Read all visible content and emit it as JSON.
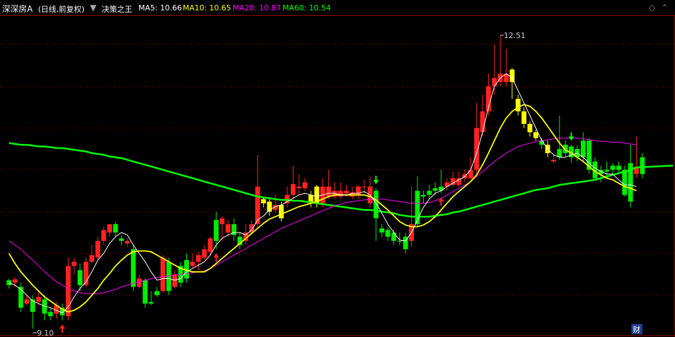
{
  "header": {
    "stock_name": "深深房A",
    "period": "(日线,前复权)",
    "indicator_name": "决策之王",
    "ma_items": [
      {
        "label": "MA5: 10.66",
        "color": "#ffffff"
      },
      {
        "label": "MA10: 10.65",
        "color": "#ffff00"
      },
      {
        "label": "MA20: 10.87",
        "color": "#ff00ff"
      },
      {
        "label": "MA60: 10.54",
        "color": "#00ff00"
      }
    ]
  },
  "chart_data": {
    "type": "candlestick",
    "colors": {
      "up": "#ff2222",
      "down": "#00ee00",
      "signal": "#ffff00",
      "grid": "#9a0000",
      "ma5": "#ffffff",
      "ma10": "#ffff00",
      "ma20": "#ff00ff",
      "ma60": "#00ff00"
    },
    "ylim": [
      8.9,
      12.75
    ],
    "annotations": {
      "high": {
        "value": 12.51,
        "label": "12.51"
      },
      "low": {
        "value": 9.1,
        "label": "9.10"
      }
    },
    "badge": "财",
    "candles": [
      [
        9.58,
        9.52,
        9.6,
        9.48,
        "down"
      ],
      [
        9.55,
        9.59,
        9.62,
        9.5,
        "up"
      ],
      [
        9.5,
        9.25,
        9.55,
        9.2,
        "down"
      ],
      [
        9.3,
        9.35,
        9.4,
        9.28,
        "up"
      ],
      [
        9.35,
        9.2,
        9.4,
        9.0,
        "down"
      ],
      [
        9.32,
        9.38,
        9.45,
        9.28,
        "up"
      ],
      [
        9.35,
        9.18,
        9.4,
        9.1,
        "down"
      ],
      [
        9.2,
        9.15,
        9.25,
        9.1,
        "down"
      ],
      [
        9.18,
        9.28,
        9.32,
        9.12,
        "up"
      ],
      [
        9.25,
        9.16,
        9.3,
        9.1,
        "down"
      ],
      [
        9.15,
        9.75,
        9.85,
        9.1,
        "up"
      ],
      [
        9.75,
        9.8,
        9.85,
        9.65,
        "up"
      ],
      [
        9.7,
        9.52,
        9.78,
        9.45,
        "down"
      ],
      [
        9.52,
        9.8,
        9.85,
        9.5,
        "up"
      ],
      [
        9.8,
        9.88,
        10.0,
        9.78,
        "up"
      ],
      [
        9.85,
        10.05,
        10.1,
        9.82,
        "up"
      ],
      [
        10.05,
        10.18,
        10.22,
        10.0,
        "up"
      ],
      [
        10.15,
        10.25,
        10.25,
        10.1,
        "up"
      ],
      [
        10.25,
        10.15,
        10.28,
        10.1,
        "down"
      ],
      [
        10.08,
        10.05,
        10.12,
        10.0,
        "down"
      ],
      [
        10.05,
        10.02,
        10.08,
        9.98,
        "up"
      ],
      [
        9.95,
        9.5,
        10.0,
        9.45,
        "down"
      ],
      [
        9.5,
        9.6,
        9.65,
        9.48,
        "up"
      ],
      [
        9.58,
        9.3,
        9.6,
        9.25,
        "down"
      ],
      [
        9.3,
        9.32,
        9.45,
        9.28,
        "down"
      ],
      [
        9.45,
        9.4,
        9.5,
        9.38,
        "down"
      ],
      [
        9.45,
        9.85,
        9.88,
        9.43,
        "up"
      ],
      [
        9.8,
        9.45,
        9.85,
        9.4,
        "down"
      ],
      [
        9.5,
        9.65,
        9.7,
        9.48,
        "up"
      ],
      [
        9.75,
        9.55,
        9.8,
        9.5,
        "down"
      ],
      [
        9.82,
        9.6,
        9.9,
        9.55,
        "down"
      ],
      [
        9.75,
        9.8,
        9.9,
        9.72,
        "up"
      ],
      [
        9.8,
        9.88,
        9.92,
        9.7,
        "up"
      ],
      [
        9.85,
        9.95,
        10.0,
        9.82,
        "up"
      ],
      [
        9.92,
        10.08,
        10.1,
        9.88,
        "up"
      ],
      [
        10.05,
        10.3,
        10.4,
        9.95,
        "down"
      ],
      [
        10.25,
        10.32,
        10.35,
        10.05,
        "up"
      ],
      [
        10.25,
        10.15,
        10.3,
        10.1,
        "up"
      ],
      [
        10.25,
        10.12,
        10.32,
        10.05,
        "down"
      ],
      [
        10.1,
        10.0,
        10.15,
        9.95,
        "down"
      ],
      [
        10.05,
        10.15,
        10.25,
        10.0,
        "up"
      ],
      [
        10.15,
        10.25,
        10.3,
        10.12,
        "up"
      ],
      [
        10.25,
        10.7,
        11.08,
        10.2,
        "up"
      ],
      [
        10.55,
        10.5,
        10.58,
        10.45,
        "signal"
      ],
      [
        10.52,
        10.4,
        10.55,
        10.35,
        "signal"
      ],
      [
        10.42,
        10.48,
        10.6,
        10.38,
        "up"
      ],
      [
        10.48,
        10.32,
        10.52,
        10.28,
        "signal"
      ],
      [
        10.5,
        10.6,
        10.7,
        10.45,
        "up"
      ],
      [
        10.6,
        10.73,
        10.95,
        10.55,
        "up"
      ],
      [
        10.7,
        10.68,
        10.85,
        10.6,
        "up"
      ],
      [
        10.75,
        10.68,
        10.8,
        10.65,
        "up"
      ],
      [
        10.6,
        10.5,
        10.65,
        10.45,
        "signal"
      ],
      [
        10.7,
        10.5,
        10.72,
        10.45,
        "signal"
      ],
      [
        10.5,
        10.7,
        10.8,
        10.45,
        "up"
      ],
      [
        10.7,
        10.58,
        10.9,
        10.55,
        "up"
      ],
      [
        10.58,
        10.65,
        10.75,
        10.55,
        "up"
      ],
      [
        10.58,
        10.65,
        10.75,
        10.55,
        "up"
      ],
      [
        10.62,
        10.65,
        10.72,
        10.58,
        "up"
      ],
      [
        10.58,
        10.63,
        10.7,
        10.55,
        "up"
      ],
      [
        10.7,
        10.6,
        10.72,
        10.55,
        "up"
      ],
      [
        10.7,
        10.7,
        10.78,
        10.62,
        "up"
      ],
      [
        10.7,
        10.5,
        10.82,
        10.45,
        "up"
      ],
      [
        10.65,
        10.32,
        10.68,
        10.05,
        "down"
      ],
      [
        10.2,
        10.15,
        10.25,
        10.1,
        "down"
      ],
      [
        10.18,
        10.1,
        10.22,
        10.05,
        "down"
      ],
      [
        10.15,
        10.05,
        10.18,
        10.0,
        "down"
      ],
      [
        10.05,
        10.05,
        10.15,
        10.0,
        "down"
      ],
      [
        10.1,
        9.95,
        10.15,
        9.9,
        "down"
      ],
      [
        10.05,
        10.25,
        10.7,
        9.98,
        "up"
      ],
      [
        10.25,
        10.65,
        10.82,
        10.22,
        "down"
      ],
      [
        10.6,
        10.58,
        10.65,
        10.5,
        "down"
      ],
      [
        10.65,
        10.6,
        10.72,
        10.55,
        "down"
      ],
      [
        10.65,
        10.68,
        10.75,
        10.6,
        "down"
      ],
      [
        10.65,
        10.7,
        10.9,
        10.62,
        "down"
      ],
      [
        10.7,
        10.75,
        10.8,
        10.65,
        "up"
      ],
      [
        10.72,
        10.8,
        10.88,
        10.7,
        "up"
      ],
      [
        10.72,
        10.8,
        10.88,
        10.7,
        "up"
      ],
      [
        10.85,
        10.8,
        10.9,
        10.75,
        "up"
      ],
      [
        10.8,
        10.9,
        11.05,
        10.78,
        "up"
      ],
      [
        10.9,
        11.4,
        11.7,
        10.85,
        "up"
      ],
      [
        11.35,
        11.6,
        11.8,
        11.3,
        "up"
      ],
      [
        11.6,
        11.9,
        12.05,
        11.55,
        "up"
      ],
      [
        11.9,
        12.0,
        12.4,
        11.8,
        "up"
      ],
      [
        11.95,
        12.05,
        12.51,
        11.9,
        "up"
      ],
      [
        12.05,
        11.95,
        12.35,
        11.9,
        "up"
      ],
      [
        11.95,
        12.1,
        12.12,
        11.75,
        "signal"
      ],
      [
        11.75,
        11.6,
        11.8,
        11.55,
        "signal"
      ],
      [
        11.6,
        11.45,
        11.65,
        11.4,
        "signal"
      ],
      [
        11.45,
        11.35,
        11.48,
        11.3,
        "signal"
      ],
      [
        11.35,
        11.28,
        11.38,
        11.25,
        "signal"
      ],
      [
        11.25,
        11.2,
        11.28,
        11.15,
        "down"
      ],
      [
        11.2,
        11.1,
        11.25,
        11.05,
        "signal"
      ],
      [
        11.0,
        11.02,
        11.08,
        10.98,
        "up"
      ],
      [
        11.05,
        11.15,
        11.55,
        11.02,
        "down"
      ],
      [
        11.2,
        11.1,
        11.25,
        11.05,
        "down"
      ],
      [
        11.18,
        11.05,
        11.2,
        10.98,
        "down"
      ],
      [
        11.15,
        11.05,
        11.2,
        11.0,
        "down"
      ],
      [
        11.05,
        11.25,
        11.35,
        11.0,
        "down"
      ],
      [
        11.25,
        10.9,
        11.28,
        10.85,
        "down"
      ],
      [
        11.0,
        10.8,
        11.05,
        10.78,
        "down"
      ],
      [
        10.85,
        10.9,
        10.95,
        10.75,
        "down"
      ],
      [
        10.9,
        10.88,
        11.0,
        10.8,
        "down"
      ],
      [
        10.9,
        10.95,
        10.98,
        10.85,
        "down"
      ],
      [
        10.95,
        10.9,
        11.0,
        10.85,
        "down"
      ],
      [
        10.9,
        10.6,
        10.95,
        10.58,
        "down"
      ],
      [
        10.98,
        10.52,
        11.2,
        10.45,
        "down"
      ],
      [
        10.85,
        10.92,
        11.3,
        10.8,
        "up"
      ],
      [
        11.05,
        10.85,
        11.1,
        10.8,
        "down"
      ]
    ],
    "ma5": [
      9.55,
      9.52,
      9.47,
      9.4,
      9.33,
      9.3,
      9.27,
      9.25,
      9.22,
      9.19,
      9.26,
      9.38,
      9.48,
      9.56,
      9.68,
      9.82,
      9.9,
      10.02,
      10.1,
      10.15,
      10.12,
      10.0,
      9.9,
      9.8,
      9.68,
      9.58,
      9.6,
      9.6,
      9.58,
      9.6,
      9.68,
      9.72,
      9.76,
      9.8,
      9.88,
      10.0,
      10.08,
      10.12,
      10.15,
      10.15,
      10.12,
      10.18,
      10.3,
      10.35,
      10.42,
      10.46,
      10.48,
      10.52,
      10.56,
      10.6,
      10.62,
      10.6,
      10.58,
      10.6,
      10.62,
      10.62,
      10.6,
      10.6,
      10.62,
      10.62,
      10.64,
      10.6,
      10.5,
      10.38,
      10.25,
      10.15,
      10.06,
      10.05,
      10.15,
      10.3,
      10.45,
      10.55,
      10.62,
      10.65,
      10.7,
      10.74,
      10.78,
      10.82,
      10.9,
      11.1,
      11.35,
      11.65,
      11.9,
      12.0,
      12.05,
      12.0,
      11.85,
      11.7,
      11.55,
      11.4,
      11.25,
      11.15,
      11.08,
      11.05,
      11.05,
      11.08,
      11.1,
      11.05,
      10.98,
      10.92,
      10.88,
      10.85,
      10.85,
      10.78,
      10.72,
      10.72,
      10.7
    ],
    "ma10": [
      9.9,
      9.78,
      9.68,
      9.6,
      9.52,
      9.45,
      9.38,
      9.33,
      9.28,
      9.23,
      9.2,
      9.22,
      9.26,
      9.32,
      9.4,
      9.48,
      9.58,
      9.66,
      9.75,
      9.82,
      9.88,
      9.92,
      9.93,
      9.93,
      9.92,
      9.88,
      9.84,
      9.8,
      9.76,
      9.72,
      9.7,
      9.68,
      9.68,
      9.68,
      9.72,
      9.78,
      9.84,
      9.9,
      9.96,
      10.02,
      10.08,
      10.14,
      10.2,
      10.26,
      10.31,
      10.34,
      10.37,
      10.4,
      10.43,
      10.46,
      10.48,
      10.5,
      10.52,
      10.55,
      10.58,
      10.6,
      10.6,
      10.6,
      10.6,
      10.6,
      10.6,
      10.58,
      10.54,
      10.48,
      10.42,
      10.35,
      10.28,
      10.24,
      10.22,
      10.22,
      10.24,
      10.28,
      10.34,
      10.42,
      10.5,
      10.58,
      10.64,
      10.7,
      10.76,
      10.84,
      10.96,
      11.1,
      11.25,
      11.4,
      11.52,
      11.6,
      11.65,
      11.68,
      11.66,
      11.6,
      11.52,
      11.42,
      11.32,
      11.22,
      11.14,
      11.1,
      11.05,
      11.0,
      10.94,
      10.88,
      10.84,
      10.8,
      10.78,
      10.74,
      10.7,
      10.68,
      10.65
    ],
    "ma20": [
      10.05,
      10.0,
      9.95,
      9.88,
      9.82,
      9.75,
      9.68,
      9.62,
      9.56,
      9.52,
      9.48,
      9.45,
      9.43,
      9.42,
      9.42,
      9.42,
      9.43,
      9.45,
      9.47,
      9.5,
      9.52,
      9.54,
      9.56,
      9.58,
      9.6,
      9.61,
      9.62,
      9.63,
      9.64,
      9.65,
      9.66,
      9.67,
      9.68,
      9.69,
      9.72,
      9.76,
      9.8,
      9.84,
      9.88,
      9.92,
      9.96,
      10.0,
      10.04,
      10.08,
      10.12,
      10.16,
      10.2,
      10.23,
      10.26,
      10.29,
      10.32,
      10.35,
      10.38,
      10.41,
      10.44,
      10.47,
      10.49,
      10.51,
      10.52,
      10.53,
      10.54,
      10.55,
      10.55,
      10.55,
      10.54,
      10.53,
      10.52,
      10.51,
      10.5,
      10.5,
      10.5,
      10.51,
      10.53,
      10.56,
      10.6,
      10.64,
      10.68,
      10.72,
      10.76,
      10.82,
      10.88,
      10.94,
      11.0,
      11.05,
      11.1,
      11.14,
      11.18,
      11.2,
      11.22,
      11.24,
      11.25,
      11.26,
      11.27,
      11.28,
      11.28,
      11.28,
      11.28,
      11.27,
      11.26,
      11.25,
      11.24,
      11.24,
      11.23,
      11.23,
      11.22,
      11.21,
      11.2
    ],
    "ma60": [
      11.22,
      11.21,
      11.2,
      11.2,
      11.19,
      11.18,
      11.18,
      11.17,
      11.16,
      11.16,
      11.15,
      11.14,
      11.13,
      11.12,
      11.1,
      11.09,
      11.08,
      11.06,
      11.05,
      11.04,
      11.02,
      11.0,
      10.98,
      10.96,
      10.94,
      10.92,
      10.9,
      10.88,
      10.86,
      10.84,
      10.82,
      10.8,
      10.78,
      10.76,
      10.74,
      10.72,
      10.7,
      10.68,
      10.66,
      10.64,
      10.62,
      10.6,
      10.58,
      10.57,
      10.56,
      10.55,
      10.54,
      10.54,
      10.53,
      10.53,
      10.52,
      10.51,
      10.5,
      10.49,
      10.48,
      10.47,
      10.46,
      10.45,
      10.44,
      10.43,
      10.42,
      10.42,
      10.41,
      10.4,
      10.39,
      10.38,
      10.36,
      10.35,
      10.34,
      10.34,
      10.34,
      10.34,
      10.35,
      10.36,
      10.37,
      10.39,
      10.4,
      10.42,
      10.44,
      10.46,
      10.48,
      10.5,
      10.52,
      10.54,
      10.56,
      10.58,
      10.6,
      10.62,
      10.64,
      10.66,
      10.67,
      10.68,
      10.7,
      10.72,
      10.73,
      10.74,
      10.75,
      10.76,
      10.77,
      10.78,
      10.8,
      10.82,
      10.84,
      10.86,
      10.88,
      10.9,
      10.93
    ],
    "signals": [
      {
        "index": 9,
        "type": "buy"
      },
      {
        "index": 35,
        "type": "buy"
      },
      {
        "index": 62,
        "type": "sell"
      },
      {
        "index": 73,
        "type": "buy"
      },
      {
        "index": 95,
        "type": "sell"
      }
    ]
  }
}
